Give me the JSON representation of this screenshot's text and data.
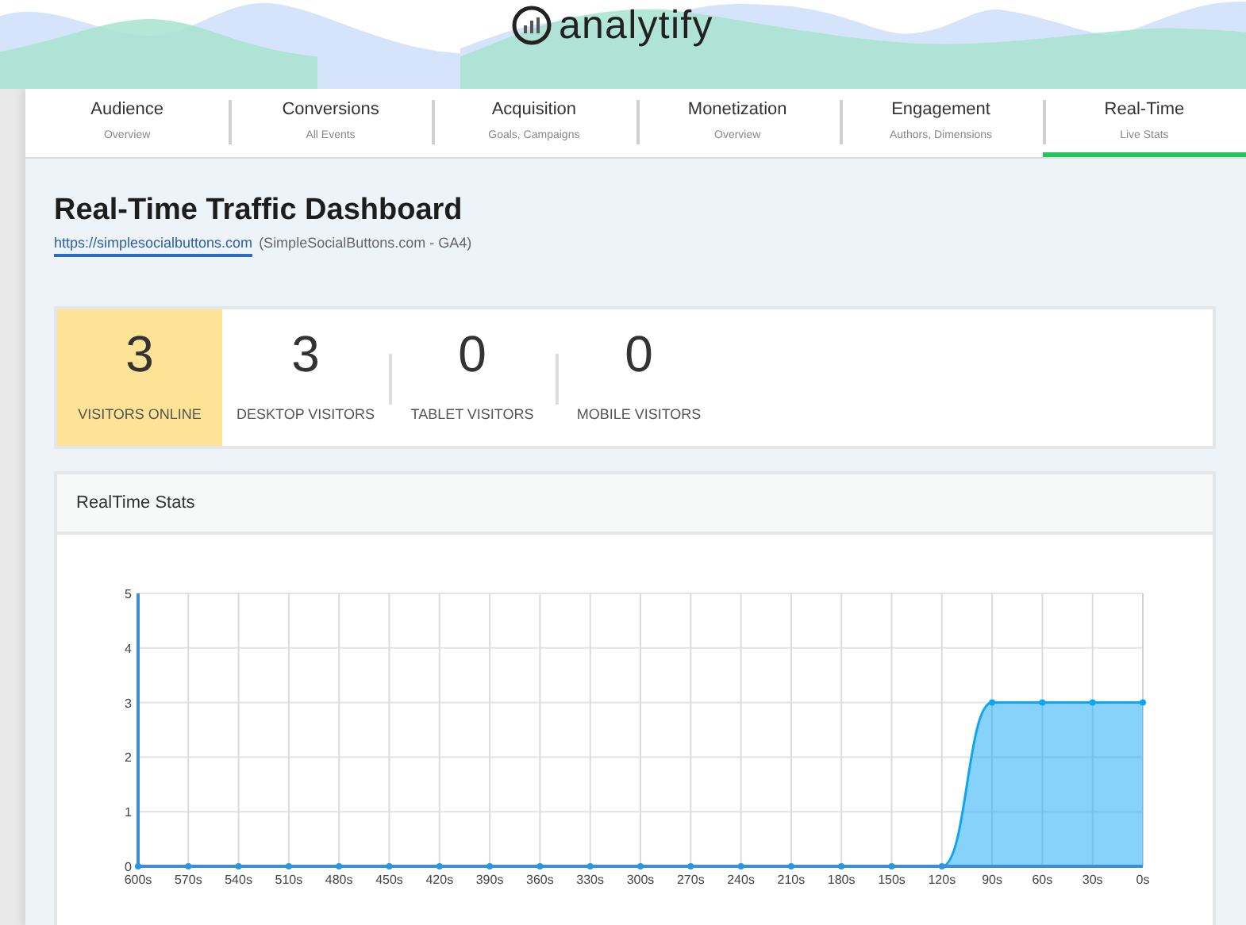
{
  "logo": {
    "text": "analytify"
  },
  "tabs": [
    {
      "label": "Audience",
      "sublabel": "Overview",
      "selected": false
    },
    {
      "label": "Conversions",
      "sublabel": "All Events",
      "selected": false
    },
    {
      "label": "Acquisition",
      "sublabel": "Goals, Campaigns",
      "selected": false
    },
    {
      "label": "Monetization",
      "sublabel": "Overview",
      "selected": false
    },
    {
      "label": "Engagement",
      "sublabel": "Authors, Dimensions",
      "selected": false
    },
    {
      "label": "Real-Time",
      "sublabel": "Live Stats",
      "selected": true
    }
  ],
  "page": {
    "title": "Real-Time Traffic Dashboard",
    "site_link": "https://simplesocialbuttons.com",
    "site_name": "(SimpleSocialButtons.com - GA4)"
  },
  "stats": [
    {
      "value": "3",
      "label": "VISITORS ONLINE",
      "selected": true
    },
    {
      "value": "3",
      "label": "DESKTOP VISITORS",
      "selected": false
    },
    {
      "value": "0",
      "label": "TABLET VISITORS",
      "selected": false
    },
    {
      "value": "0",
      "label": "MOBILE VISITORS",
      "selected": false
    }
  ],
  "realtime": {
    "title": "RealTime Stats",
    "chart_data": {
      "type": "area",
      "categories": [
        "600s",
        "570s",
        "540s",
        "510s",
        "480s",
        "450s",
        "420s",
        "390s",
        "360s",
        "330s",
        "300s",
        "270s",
        "240s",
        "210s",
        "180s",
        "150s",
        "120s",
        "90s",
        "60s",
        "30s",
        "0s"
      ],
      "series": [
        {
          "color": "#0ea5f5",
          "values": [
            0,
            0,
            0,
            0,
            0,
            0,
            0,
            0,
            0,
            0,
            0,
            0,
            0,
            0,
            0,
            0,
            0,
            3,
            3,
            3,
            3
          ]
        }
      ],
      "grid": true,
      "ylim": [
        0,
        5
      ],
      "yticks": [
        0,
        1,
        2,
        3,
        4,
        5
      ]
    }
  }
}
